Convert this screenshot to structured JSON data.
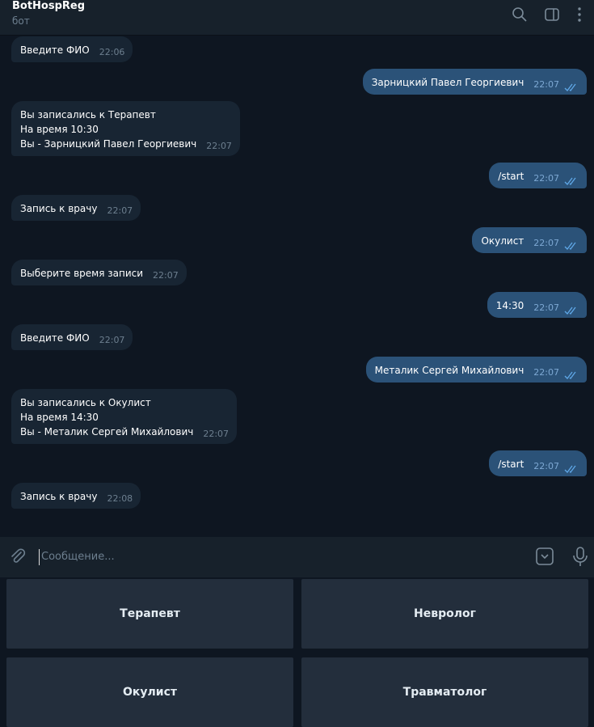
{
  "header": {
    "title": "BotHospReg",
    "subtitle": "бот"
  },
  "messages": [
    {
      "dir": "in",
      "text": "Введите ФИО",
      "time": "22:06"
    },
    {
      "dir": "out",
      "text": "Зарницкий Павел Георгиевич",
      "time": "22:07"
    },
    {
      "dir": "in",
      "text": "Вы записались к Терапевт\nНа время 10:30\nВы - Зарницкий Павел Георгиевич",
      "time": "22:07"
    },
    {
      "dir": "out",
      "text": "/start",
      "time": "22:07"
    },
    {
      "dir": "in",
      "text": "Запись к врачу",
      "time": "22:07"
    },
    {
      "dir": "out",
      "text": "Окулист",
      "time": "22:07"
    },
    {
      "dir": "in",
      "text": "Выберите время записи",
      "time": "22:07"
    },
    {
      "dir": "out",
      "text": "14:30",
      "time": "22:07"
    },
    {
      "dir": "in",
      "text": "Введите ФИО",
      "time": "22:07"
    },
    {
      "dir": "out",
      "text": "Металик Сергей Михайлович",
      "time": "22:07"
    },
    {
      "dir": "in",
      "text": "Вы записались к Окулист\nНа время 14:30\nВы - Металик Сергей Михайлович",
      "time": "22:07"
    },
    {
      "dir": "out",
      "text": "/start",
      "time": "22:07"
    },
    {
      "dir": "in",
      "text": "Запись к врачу",
      "time": "22:08"
    }
  ],
  "input": {
    "placeholder": "Сообщение..."
  },
  "keyboard": [
    "Терапевт",
    "Невролог",
    "Окулист",
    "Травматолог"
  ]
}
